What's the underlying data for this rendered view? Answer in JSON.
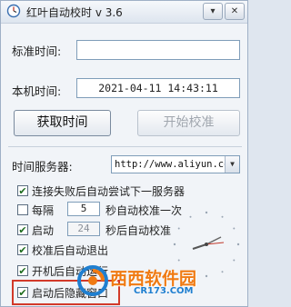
{
  "window": {
    "title": "红叶自动校时 v 3.6",
    "minimize_symbol": "▾",
    "close_symbol": "✕"
  },
  "form": {
    "standard_time_label": "标准时间:",
    "standard_time_value": "",
    "local_time_label": "本机时间:",
    "local_time_value": "2021-04-11  14:43:11",
    "fetch_button": "获取时间",
    "start_button": "开始校准",
    "server_label": "时间服务器:",
    "server_value": "http://www.aliyun.com"
  },
  "options": [
    {
      "checked": true,
      "text": "连接失败后自动尝试下一服务器"
    },
    {
      "checked": false,
      "text_before": "每隔",
      "number": "5",
      "text_after": "秒自动校准一次"
    },
    {
      "checked": true,
      "text_before": "启动",
      "number": "24",
      "text_after": "秒后自动校准"
    },
    {
      "checked": true,
      "text": "校准后自动退出"
    },
    {
      "checked": true,
      "text": "开机后自动运行"
    },
    {
      "checked": true,
      "text": "启动后隐藏窗口"
    }
  ],
  "watermark": {
    "brand": "西西软件园",
    "url": "CR173.COM"
  },
  "colors": {
    "highlight_box": "#d23a2a",
    "checkmark": "#1c6b1c",
    "watermark_orange": "#f07a12",
    "watermark_blue": "#1f7fd0"
  }
}
